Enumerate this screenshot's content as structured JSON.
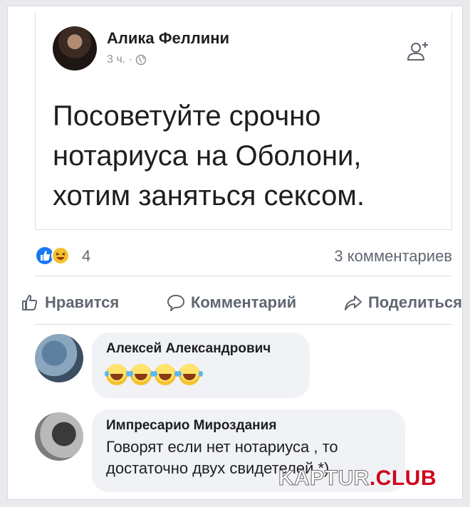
{
  "post": {
    "author": "Алика Феллини",
    "meta": "3 ч. ·",
    "text": "Посоветуйте срочно нотариуса на Оболони, хотим заняться сексом."
  },
  "reactions": {
    "count": "4",
    "comments": "3 комментариев"
  },
  "actions": {
    "like": "Нравится",
    "comment": "Комментарий",
    "share": "Поделиться"
  },
  "comments": [
    {
      "author": "Алексей Александрович",
      "text": ""
    },
    {
      "author": "Импресарио Мироздания",
      "text": "Говорят если нет нотариуса , то достаточно двух свидетелей *)"
    }
  ],
  "watermark": {
    "main": "KAPTUR",
    "accent": ".CLUB"
  },
  "colors": {
    "like_blue": "#1877f2",
    "text_gray": "#606770",
    "bubble": "#f0f2f5"
  },
  "icons": [
    "globe-icon",
    "add-friend-icon",
    "like-icon",
    "comment-icon",
    "share-icon",
    "laugh-emoji"
  ]
}
